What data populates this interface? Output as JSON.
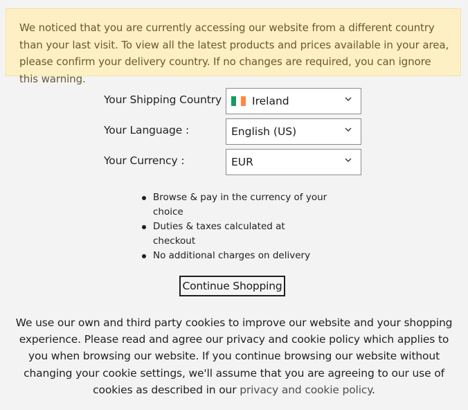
{
  "warning": {
    "text": "We noticed that you are currently accessing our website from a different country than your last visit. To view all the latest products and prices available in your area, please confirm your delivery country. If no changes are required, you can ignore this warning."
  },
  "shipping": {
    "label": "Your Shipping Country :",
    "value": "Ireland",
    "flag_colors": [
      "#169b62",
      "#ffffff",
      "#ff883e"
    ]
  },
  "language": {
    "label": "Your Language :",
    "value": "English (US)"
  },
  "currency": {
    "label": "Your Currency :",
    "value": "EUR"
  },
  "benefits": [
    "Browse & pay in the currency of your choice",
    "Duties & taxes calculated at checkout",
    "No additional charges on delivery"
  ],
  "continue_button": "Continue Shopping",
  "cookie": {
    "text": "We use our own and third party cookies to improve our website and your shopping experience. Please read and agree our privacy and cookie policy which applies to you when browsing our website. If you continue browsing our website without changing your cookie settings, we'll assume that you are agreeing to our use of cookies as described in our ",
    "link": "privacy and cookie policy",
    "end": "."
  },
  "icons": {
    "dropdown": "chevron-down-icon",
    "bullet": "bullet-icon",
    "flag": "ireland-flag-icon"
  }
}
